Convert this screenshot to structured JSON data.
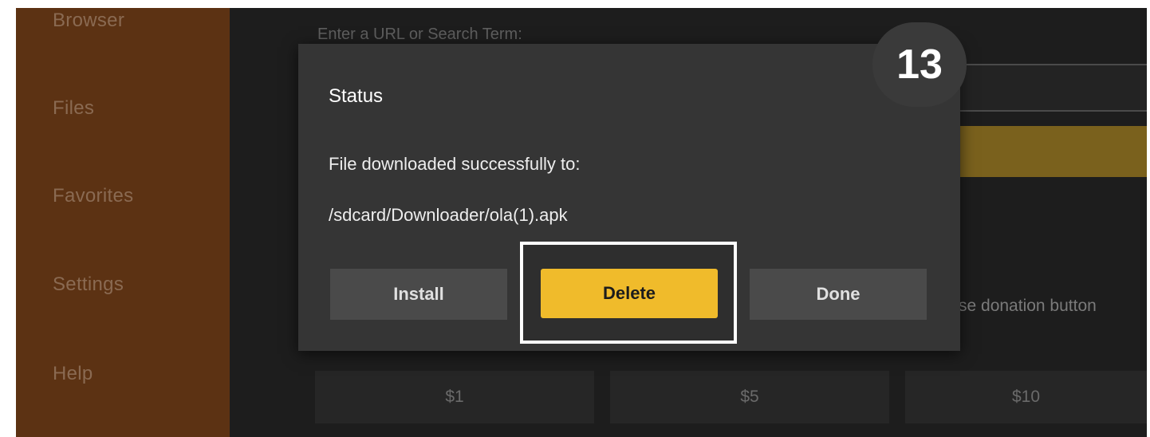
{
  "sidebar": {
    "items": [
      {
        "label": "Browser"
      },
      {
        "label": "Files"
      },
      {
        "label": "Favorites"
      },
      {
        "label": "Settings"
      },
      {
        "label": "Help"
      }
    ]
  },
  "main": {
    "url_label": "Enter a URL or Search Term:",
    "donate_text": "se donation button",
    "amounts": [
      "$1",
      "$5",
      "$10"
    ]
  },
  "dialog": {
    "title": "Status",
    "message": "File downloaded successfully to:",
    "path": "/sdcard/Downloader/ola(1).apk",
    "buttons": {
      "install": "Install",
      "delete": "Delete",
      "done": "Done"
    }
  },
  "step_badge": "13",
  "colors": {
    "sidebar": "#5c3213",
    "accent": "#f0bb2b",
    "dialog": "#353535"
  }
}
